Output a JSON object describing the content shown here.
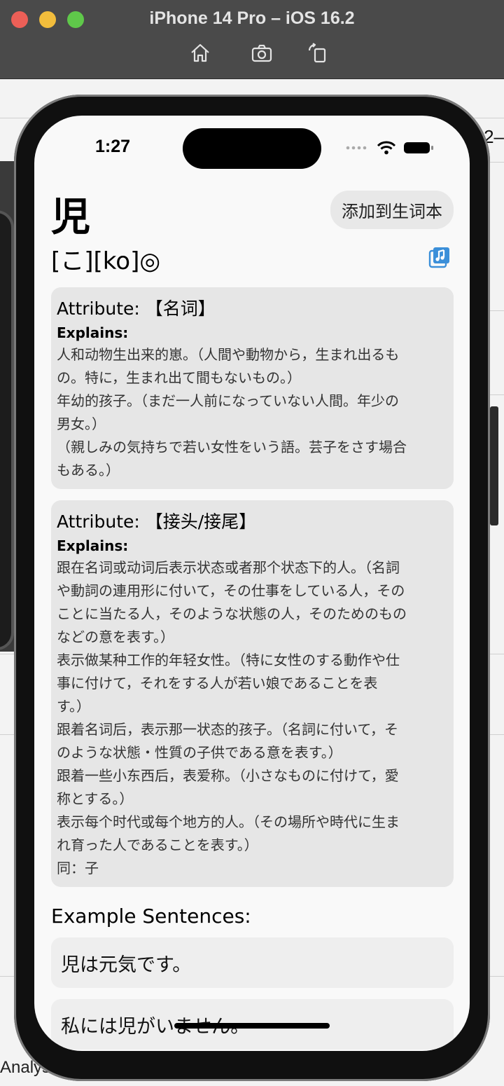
{
  "window": {
    "title": "iPhone 14 Pro – iOS 16.2",
    "toolbar_icons": [
      "home-icon",
      "screenshot-icon",
      "rotate-icon"
    ]
  },
  "background": {
    "right_text": "2–",
    "bottom_text": "Analys"
  },
  "status_bar": {
    "time": "1:27"
  },
  "entry": {
    "word": "児",
    "add_button": "添加到生词本",
    "reading": "[こ][ko]◎",
    "audio_icon": "music-note-stack-icon"
  },
  "definitions": [
    {
      "attribute": "Attribute: 【名词】",
      "explains_label": "Explains:",
      "lines": [
        "人和动物生出来的崽。（人間や動物から，生まれ出るも",
        "の。特に，生まれ出て間もないもの。）",
        "年幼的孩子。（まだ一人前になっていない人間。年少の",
        "男女。）",
        "（親しみの気持ちで若い女性をいう語。芸子をさす場合",
        "もある。）"
      ]
    },
    {
      "attribute": "Attribute: 【接头/接尾】",
      "explains_label": "Explains:",
      "lines": [
        "跟在名词或动词后表示状态或者那个状态下的人。（名詞",
        "や動詞の連用形に付いて，その仕事をしている人，その",
        "ことに当たる人，そのような状態の人，そのためのもの",
        "などの意を表す。）",
        "表示做某种工作的年轻女性。（特に女性のする動作や仕",
        "事に付けて，それをする人が若い娘であることを表",
        "す。）",
        "跟着名词后，表示那一状态的孩子。（名詞に付いて，そ",
        "のような状態・性質の子供である意を表す。）",
        "跟着一些小东西后，表爱称。（小さなものに付けて，愛",
        "称とする。）",
        "表示每个时代或每个地方的人。（その場所や時代に生ま",
        "れ育った人であることを表す。）",
        "同：子"
      ]
    }
  ],
  "examples": {
    "title": "Example Sentences:",
    "items": [
      "児は元気です。",
      "私には児がいません。"
    ]
  },
  "colors": {
    "accent": "#3b8fd9",
    "card_bg": "#e6e6e6",
    "screen_bg": "#f9f9f9",
    "titlebar_bg": "#4a4a4a"
  }
}
